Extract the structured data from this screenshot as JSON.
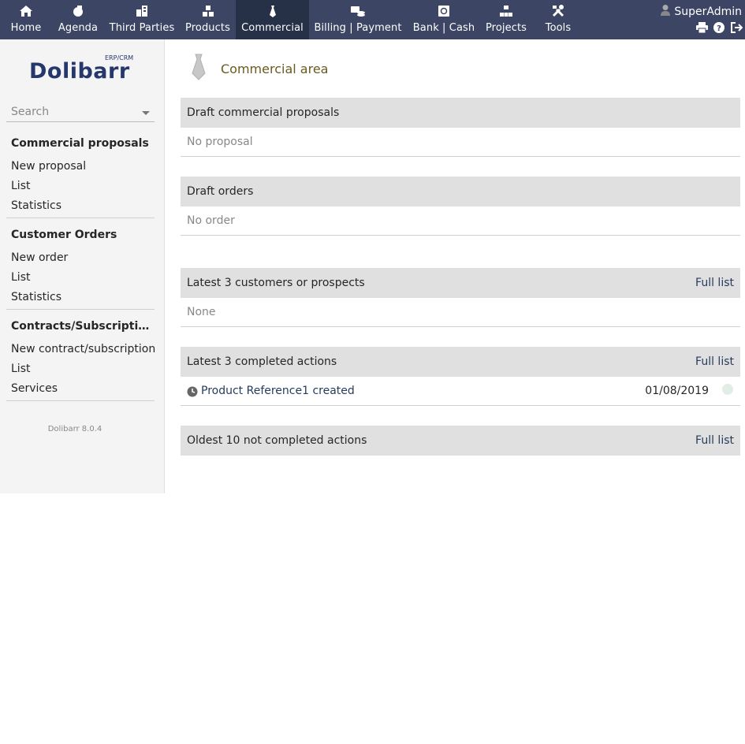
{
  "topbar": {
    "items": [
      {
        "label": "Home",
        "icon": "home-icon"
      },
      {
        "label": "Agenda",
        "icon": "agenda-icon"
      },
      {
        "label": "Third Parties",
        "icon": "buildings-icon"
      },
      {
        "label": "Products",
        "icon": "cubes-icon"
      },
      {
        "label": "Commercial",
        "icon": "tie-icon",
        "active": true
      },
      {
        "label": "Billing | Payment",
        "icon": "money-icon"
      },
      {
        "label": "Bank | Cash",
        "icon": "safe-icon"
      },
      {
        "label": "Projects",
        "icon": "sitemap-icon"
      },
      {
        "label": "Tools",
        "icon": "tools-icon"
      }
    ],
    "user": "SuperAdmin"
  },
  "sidebar": {
    "logo_text": "Dolibarr",
    "logo_sub": "ERP/CRM",
    "search_placeholder": "Search",
    "sections": [
      {
        "title": "Commercial proposals",
        "links": [
          "New proposal",
          "List",
          "Statistics"
        ]
      },
      {
        "title": "Customer Orders",
        "links": [
          "New order",
          "List",
          "Statistics"
        ]
      },
      {
        "title": "Contracts/Subscriptions",
        "links": [
          "New contract/subscription",
          "List",
          "Services"
        ]
      }
    ],
    "version": "Dolibarr 8.0.4"
  },
  "main": {
    "title": "Commercial area",
    "panels": [
      {
        "title": "Draft commercial proposals",
        "row": "No proposal"
      },
      {
        "title": "Draft orders",
        "row": "No order"
      },
      {
        "title": "Latest 3 customers or prospects",
        "link": "Full list",
        "row": "None"
      },
      {
        "title": "Latest 3 completed actions",
        "link": "Full list",
        "action": {
          "label": "Product Reference1 created",
          "date": "01/08/2019"
        }
      },
      {
        "title": "Oldest 10 not completed actions",
        "link": "Full list"
      }
    ]
  },
  "colors": {
    "topbar": "#3c4664",
    "active_tab": "#263046",
    "link": "#263c5c",
    "title": "#6b5a1e"
  }
}
